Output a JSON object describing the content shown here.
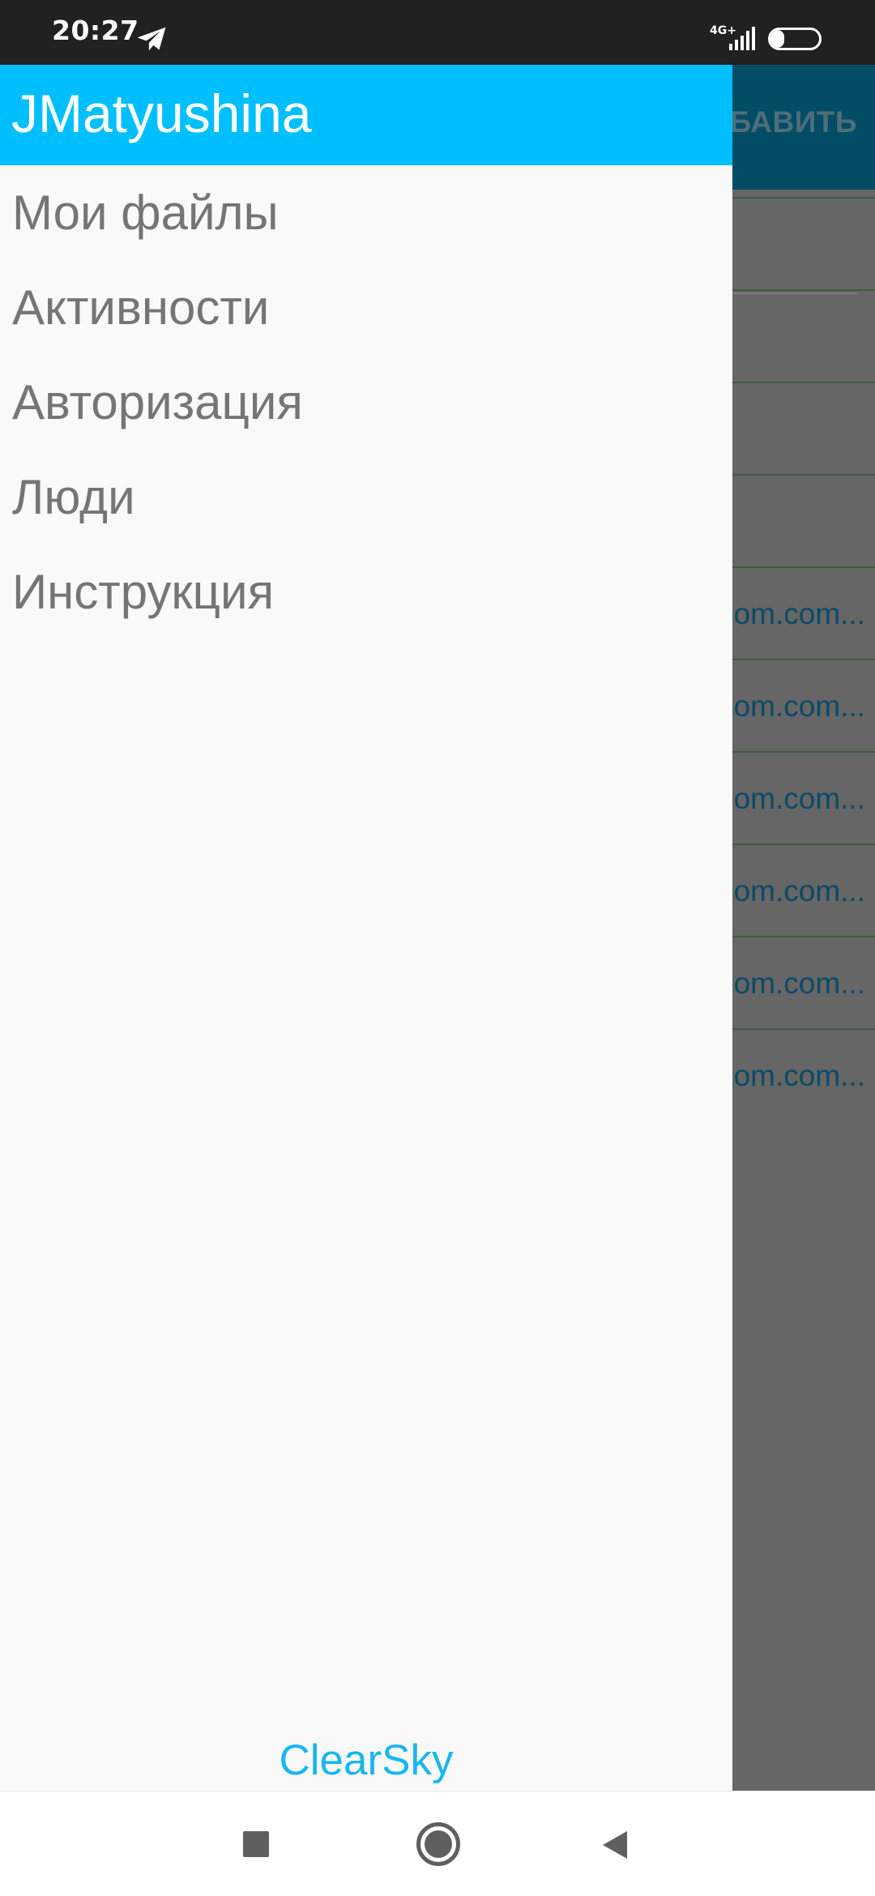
{
  "status_bar": {
    "time": "20:27",
    "network_type": "4G+",
    "battery_level": "28",
    "battery_fraction": 0.28,
    "icons": [
      "telegram-icon",
      "signal-icon",
      "battery-icon"
    ]
  },
  "background_app": {
    "toolbar_action_label": "БАВИТЬ",
    "list_items": [
      {
        "text": ""
      },
      {
        "text": ""
      },
      {
        "text": ""
      },
      {
        "text": ""
      },
      {
        "text": "om.com..."
      },
      {
        "text": "om.com..."
      },
      {
        "text": "om.com..."
      },
      {
        "text": "om.com..."
      },
      {
        "text": "om.com..."
      },
      {
        "text": "om.com..."
      }
    ]
  },
  "drawer": {
    "username": "JMatyushina",
    "menu_items": [
      {
        "label": "Мои файлы"
      },
      {
        "label": "Активности"
      },
      {
        "label": "Авторизация"
      },
      {
        "label": "Люди"
      },
      {
        "label": "Инструкция"
      }
    ],
    "footer_brand": "ClearSky"
  },
  "colors": {
    "drawer_header": "#00bfff",
    "brand_accent": "#19b6ef",
    "menu_text": "#757575",
    "scrim": "#666666",
    "status_bar": "#212121"
  },
  "navigation_bar": {
    "icons": [
      "recents-icon",
      "home-icon",
      "back-icon"
    ]
  }
}
